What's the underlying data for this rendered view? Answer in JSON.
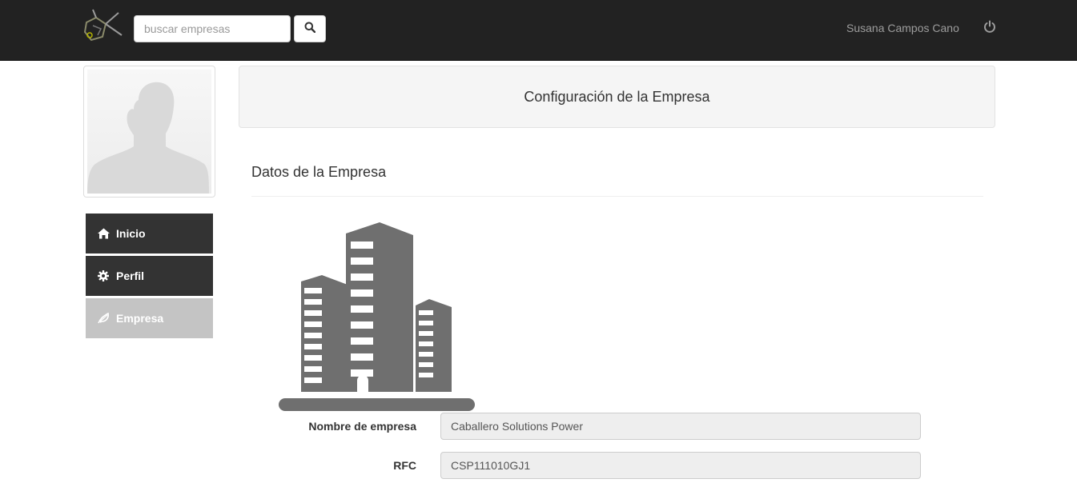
{
  "navbar": {
    "search": {
      "placeholder": "buscar empresas",
      "value": ""
    },
    "user_name": "Susana Campos Cano",
    "icons": {
      "logo": "drone-logo",
      "search": "search-icon",
      "power": "power-icon"
    }
  },
  "sidebar": {
    "items": [
      {
        "label": "Inicio",
        "icon": "home-icon",
        "active": false
      },
      {
        "label": "Perfil",
        "icon": "gear-icon",
        "active": false
      },
      {
        "label": "Empresa",
        "icon": "leaf-icon",
        "active": true
      }
    ]
  },
  "main": {
    "header_title": "Configuración de la Empresa",
    "section_title": "Datos de la Empresa",
    "form": {
      "fields": [
        {
          "label": "Nombre de empresa",
          "value": "Caballero Solutions Power"
        },
        {
          "label": "RFC",
          "value": "CSP111010GJ1"
        }
      ]
    }
  },
  "colors": {
    "navbar_bg": "#222222",
    "sidebar_dark": "#333333",
    "sidebar_active": "#c4c4c4",
    "building_gray": "#6f6f6f"
  }
}
